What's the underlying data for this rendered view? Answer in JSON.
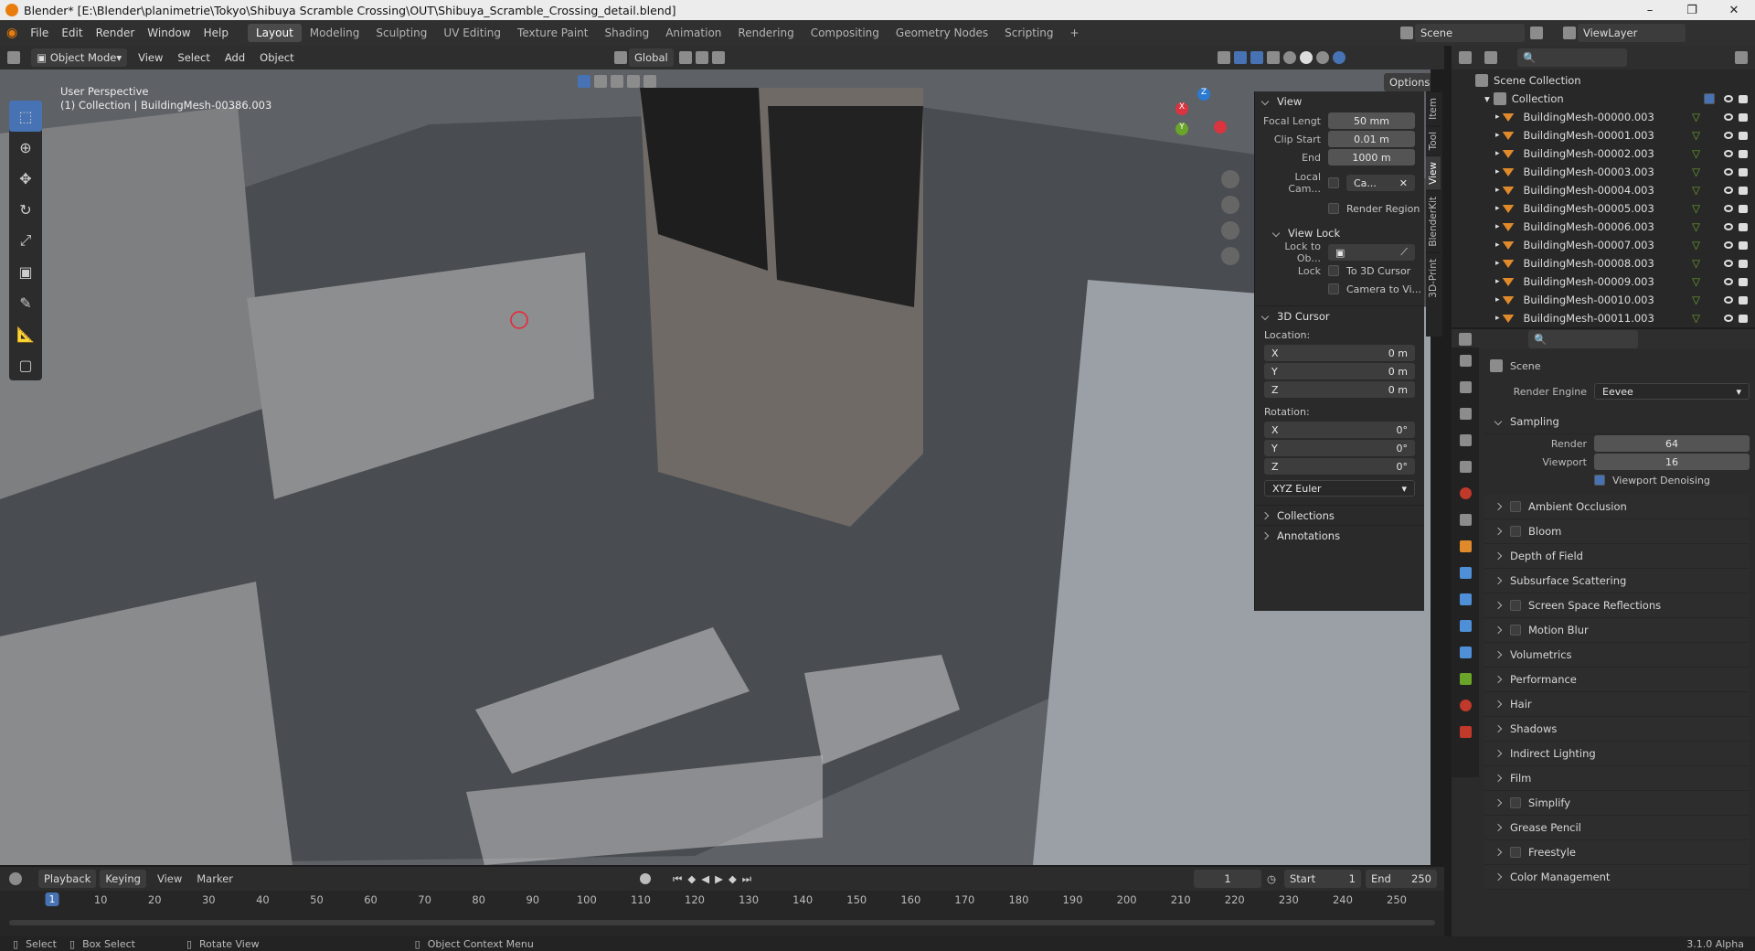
{
  "window": {
    "title": "Blender* [E:\\Blender\\planimetrie\\Tokyo\\Shibuya Scramble Crossing\\OUT\\Shibuya_Scramble_Crossing_detail.blend]",
    "min": "–",
    "max": "❐",
    "close": "✕"
  },
  "menu": [
    "File",
    "Edit",
    "Render",
    "Window",
    "Help"
  ],
  "workspaces": [
    "Layout",
    "Modeling",
    "Sculpting",
    "UV Editing",
    "Texture Paint",
    "Shading",
    "Animation",
    "Rendering",
    "Compositing",
    "Geometry Nodes",
    "Scripting",
    "+"
  ],
  "topright": {
    "scene": "Scene",
    "view_layer": "ViewLayer"
  },
  "header": {
    "mode": "Object Mode",
    "menus": [
      "View",
      "Select",
      "Add",
      "Object"
    ],
    "orientation": "Global",
    "options": "Options"
  },
  "viewport": {
    "perspective": "User Perspective",
    "collection": "(1) Collection | BuildingMesh-00386.003",
    "sky_color": "#6e7277",
    "ground_color": "#4a4d52"
  },
  "side_tabs": [
    "Item",
    "Tool",
    "View",
    "BlenderKit",
    "3D-Print"
  ],
  "npanel": {
    "view_title": "View",
    "focal_label": "Focal Lengt",
    "focal_value": "50 mm",
    "clip_start_label": "Clip Start",
    "clip_start_value": "0.01 m",
    "end_label": "End",
    "end_value": "1000 m",
    "local_cam_label": "Local Cam...",
    "local_cam_value": "Ca...",
    "render_region": "Render Region",
    "view_lock_title": "View Lock",
    "lock_to_obj": "Lock to Ob...",
    "lock_label": "Lock",
    "to_3d_cursor": "To 3D Cursor",
    "camera_to_view": "Camera to Vi...",
    "cursor_title": "3D Cursor",
    "location": "Location:",
    "loc": [
      {
        "axis": "X",
        "value": "0 m"
      },
      {
        "axis": "Y",
        "value": "0 m"
      },
      {
        "axis": "Z",
        "value": "0 m"
      }
    ],
    "rotation": "Rotation:",
    "rot": [
      {
        "axis": "X",
        "value": "0°"
      },
      {
        "axis": "Y",
        "value": "0°"
      },
      {
        "axis": "Z",
        "value": "0°"
      }
    ],
    "euler": "XYZ Euler",
    "collections": "Collections",
    "annotations": "Annotations"
  },
  "outliner": {
    "scene_collection": "Scene Collection",
    "collection": "Collection",
    "items": [
      "BuildingMesh-00000.003",
      "BuildingMesh-00001.003",
      "BuildingMesh-00002.003",
      "BuildingMesh-00003.003",
      "BuildingMesh-00004.003",
      "BuildingMesh-00005.003",
      "BuildingMesh-00006.003",
      "BuildingMesh-00007.003",
      "BuildingMesh-00008.003",
      "BuildingMesh-00009.003",
      "BuildingMesh-00010.003",
      "BuildingMesh-00011.003"
    ]
  },
  "properties": {
    "scene": "Scene",
    "render_engine_label": "Render Engine",
    "render_engine": "Eevee",
    "sampling": "Sampling",
    "render_label": "Render",
    "render_value": "64",
    "viewport_label": "Viewport",
    "viewport_value": "16",
    "viewport_denoising": "Viewport Denoising",
    "sections": [
      {
        "label": "Ambient Occlusion",
        "check": true
      },
      {
        "label": "Bloom",
        "check": true
      },
      {
        "label": "Depth of Field",
        "check": false
      },
      {
        "label": "Subsurface Scattering",
        "check": false
      },
      {
        "label": "Screen Space Reflections",
        "check": true
      },
      {
        "label": "Motion Blur",
        "check": true
      },
      {
        "label": "Volumetrics",
        "check": false
      },
      {
        "label": "Performance",
        "check": false
      },
      {
        "label": "Hair",
        "check": false
      },
      {
        "label": "Shadows",
        "check": false
      },
      {
        "label": "Indirect Lighting",
        "check": false
      },
      {
        "label": "Film",
        "check": false
      },
      {
        "label": "Simplify",
        "check": true
      },
      {
        "label": "Grease Pencil",
        "check": false
      },
      {
        "label": "Freestyle",
        "check": true
      },
      {
        "label": "Color Management",
        "check": false
      }
    ]
  },
  "timeline": {
    "menus": [
      "Playback",
      "Keying",
      "View",
      "Marker"
    ],
    "current": "1",
    "start_label": "Start",
    "start": "1",
    "end_label": "End",
    "end": "250",
    "ticks": [
      "10",
      "20",
      "30",
      "40",
      "50",
      "60",
      "70",
      "80",
      "90",
      "100",
      "110",
      "120",
      "130",
      "140",
      "150",
      "160",
      "170",
      "180",
      "190",
      "200",
      "210",
      "220",
      "230",
      "240",
      "250"
    ]
  },
  "status": {
    "select": "Select",
    "box_select": "Box Select",
    "rotate": "Rotate View",
    "context": "Object Context Menu",
    "version": "3.1.0 Alpha"
  }
}
